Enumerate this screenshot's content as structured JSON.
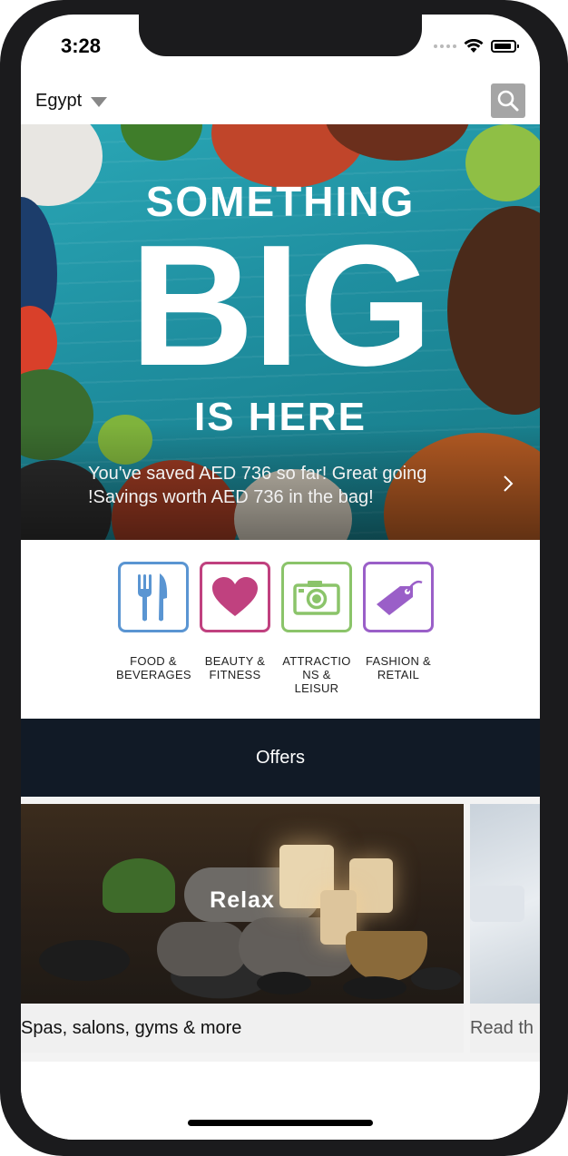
{
  "status_bar": {
    "time": "3:28"
  },
  "header": {
    "country": "Egypt",
    "search_icon": "search-icon"
  },
  "hero": {
    "line1": "SOMETHING",
    "line2": "BIG",
    "line3": "IS HERE",
    "savings_text": "You've saved AED 736 so far! Great going !Savings worth AED 736 in the bag!"
  },
  "categories": [
    {
      "label": "FOOD & BEVERAGES",
      "icon": "fork-knife-icon",
      "color": "#5a95d2"
    },
    {
      "label": "BEAUTY & FITNESS",
      "icon": "heart-icon",
      "color": "#c0417f"
    },
    {
      "label": "ATTRACTIO NS & LEISUR",
      "icon": "camera-icon",
      "color": "#8bc46a"
    },
    {
      "label": "FASHION & RETAIL",
      "icon": "tag-icon",
      "color": "#9a5fc8"
    }
  ],
  "offers": {
    "title": "Offers"
  },
  "cards": [
    {
      "image_label": "Relax",
      "caption": "Spas, salons, gyms & more"
    },
    {
      "image_label": "",
      "caption": "Read th"
    }
  ]
}
